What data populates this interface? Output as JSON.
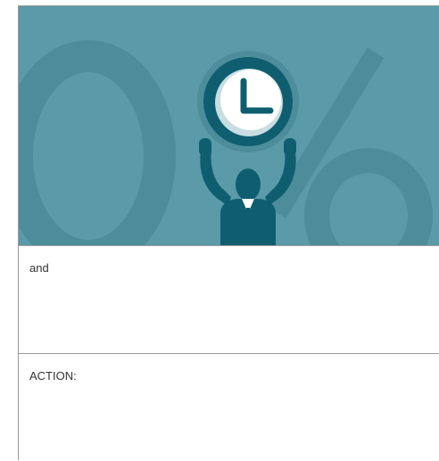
{
  "hero": {
    "background_color": "#5b9aa8",
    "decoration_color": "#4d8d9b",
    "figure_color": "#0e5e70",
    "decorative_glyph": "0%",
    "icon": "clock-icon",
    "figure": "businessman-raising-clock-icon"
  },
  "sections": [
    {
      "text": "and"
    },
    {
      "text": "ACTION:"
    }
  ]
}
